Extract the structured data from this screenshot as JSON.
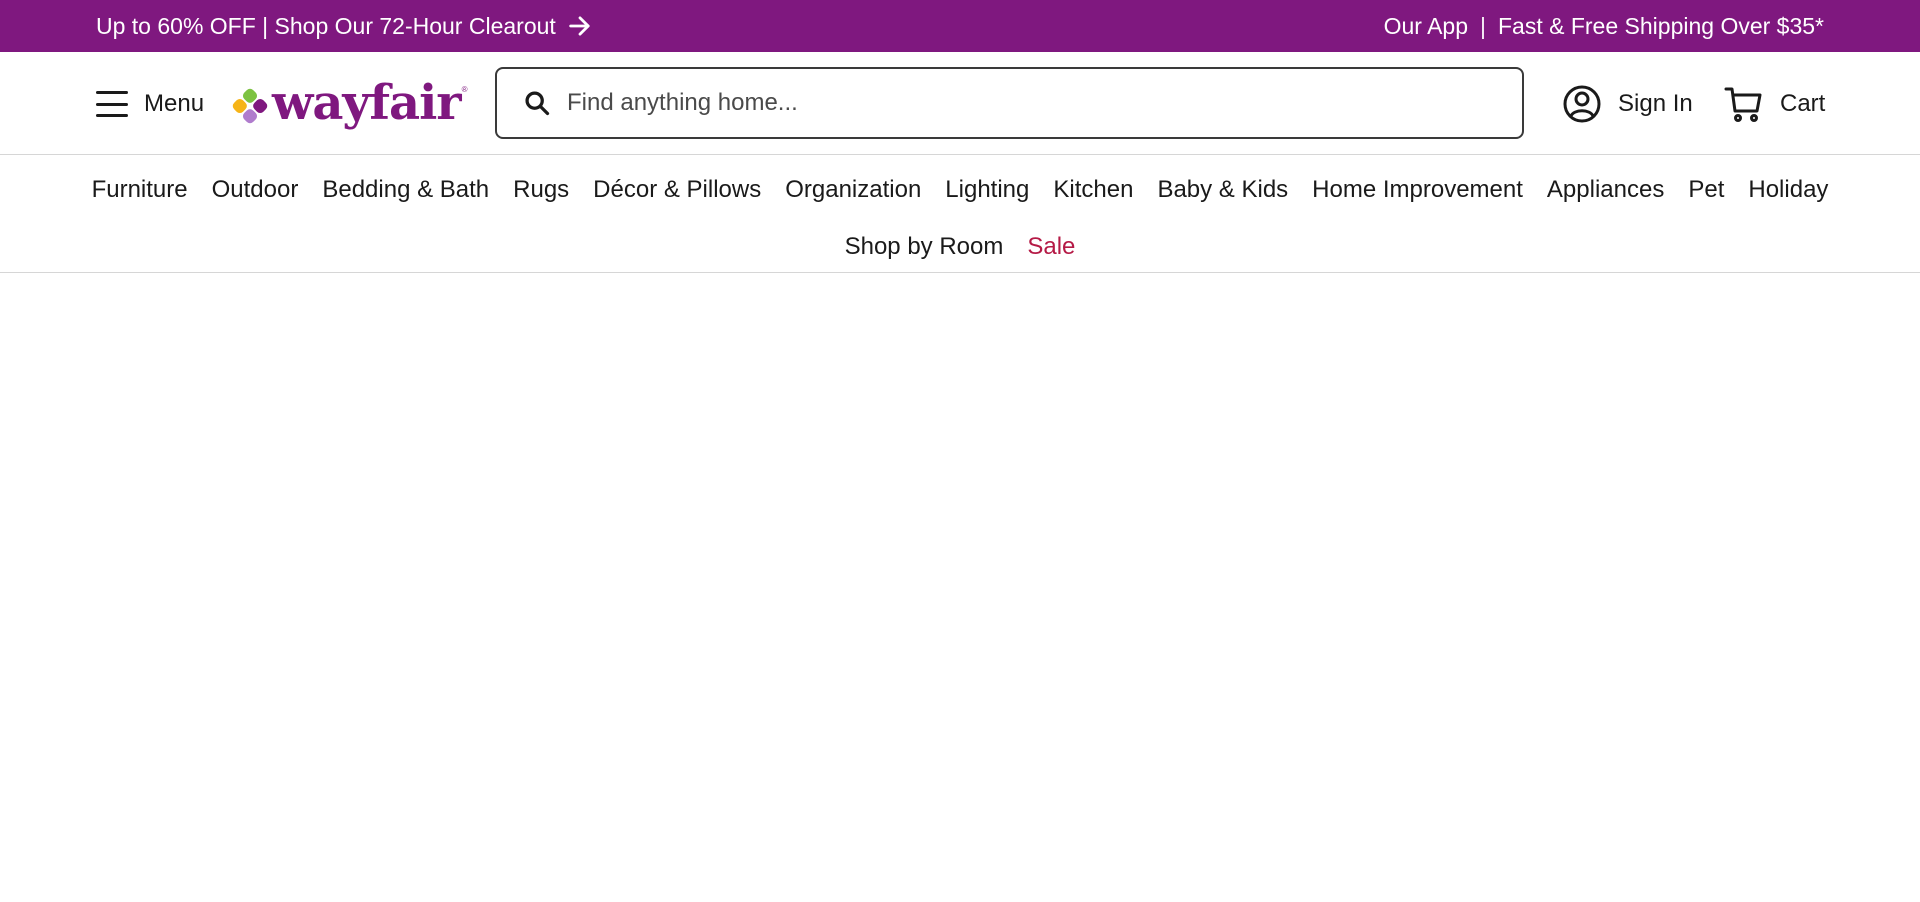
{
  "promo": {
    "left_text": "Up to 60% OFF | Shop Our 72-Hour Clearout",
    "app_link": "Our App",
    "separator": "|",
    "shipping_text": "Fast & Free Shipping Over $35*"
  },
  "header": {
    "menu_label": "Menu",
    "logo_text": "wayfair",
    "logo_reg": "®",
    "search_placeholder": "Find anything home...",
    "search_value": "",
    "signin_label": "Sign In",
    "cart_label": "Cart"
  },
  "categories": {
    "row1": [
      "Furniture",
      "Outdoor",
      "Bedding & Bath",
      "Rugs",
      "Décor & Pillows",
      "Organization",
      "Lighting",
      "Kitchen",
      "Baby & Kids",
      "Home Improvement",
      "Appliances",
      "Pet",
      "Holiday"
    ],
    "row2": [
      "Shop by Room",
      "Sale"
    ]
  },
  "colors": {
    "brand_purple": "#7f187f",
    "sale_red": "#b51a46",
    "logo_green": "#7dc242",
    "logo_yellow": "#f6b417",
    "logo_purple": "#7f187f",
    "logo_lavender": "#b07ccd"
  }
}
